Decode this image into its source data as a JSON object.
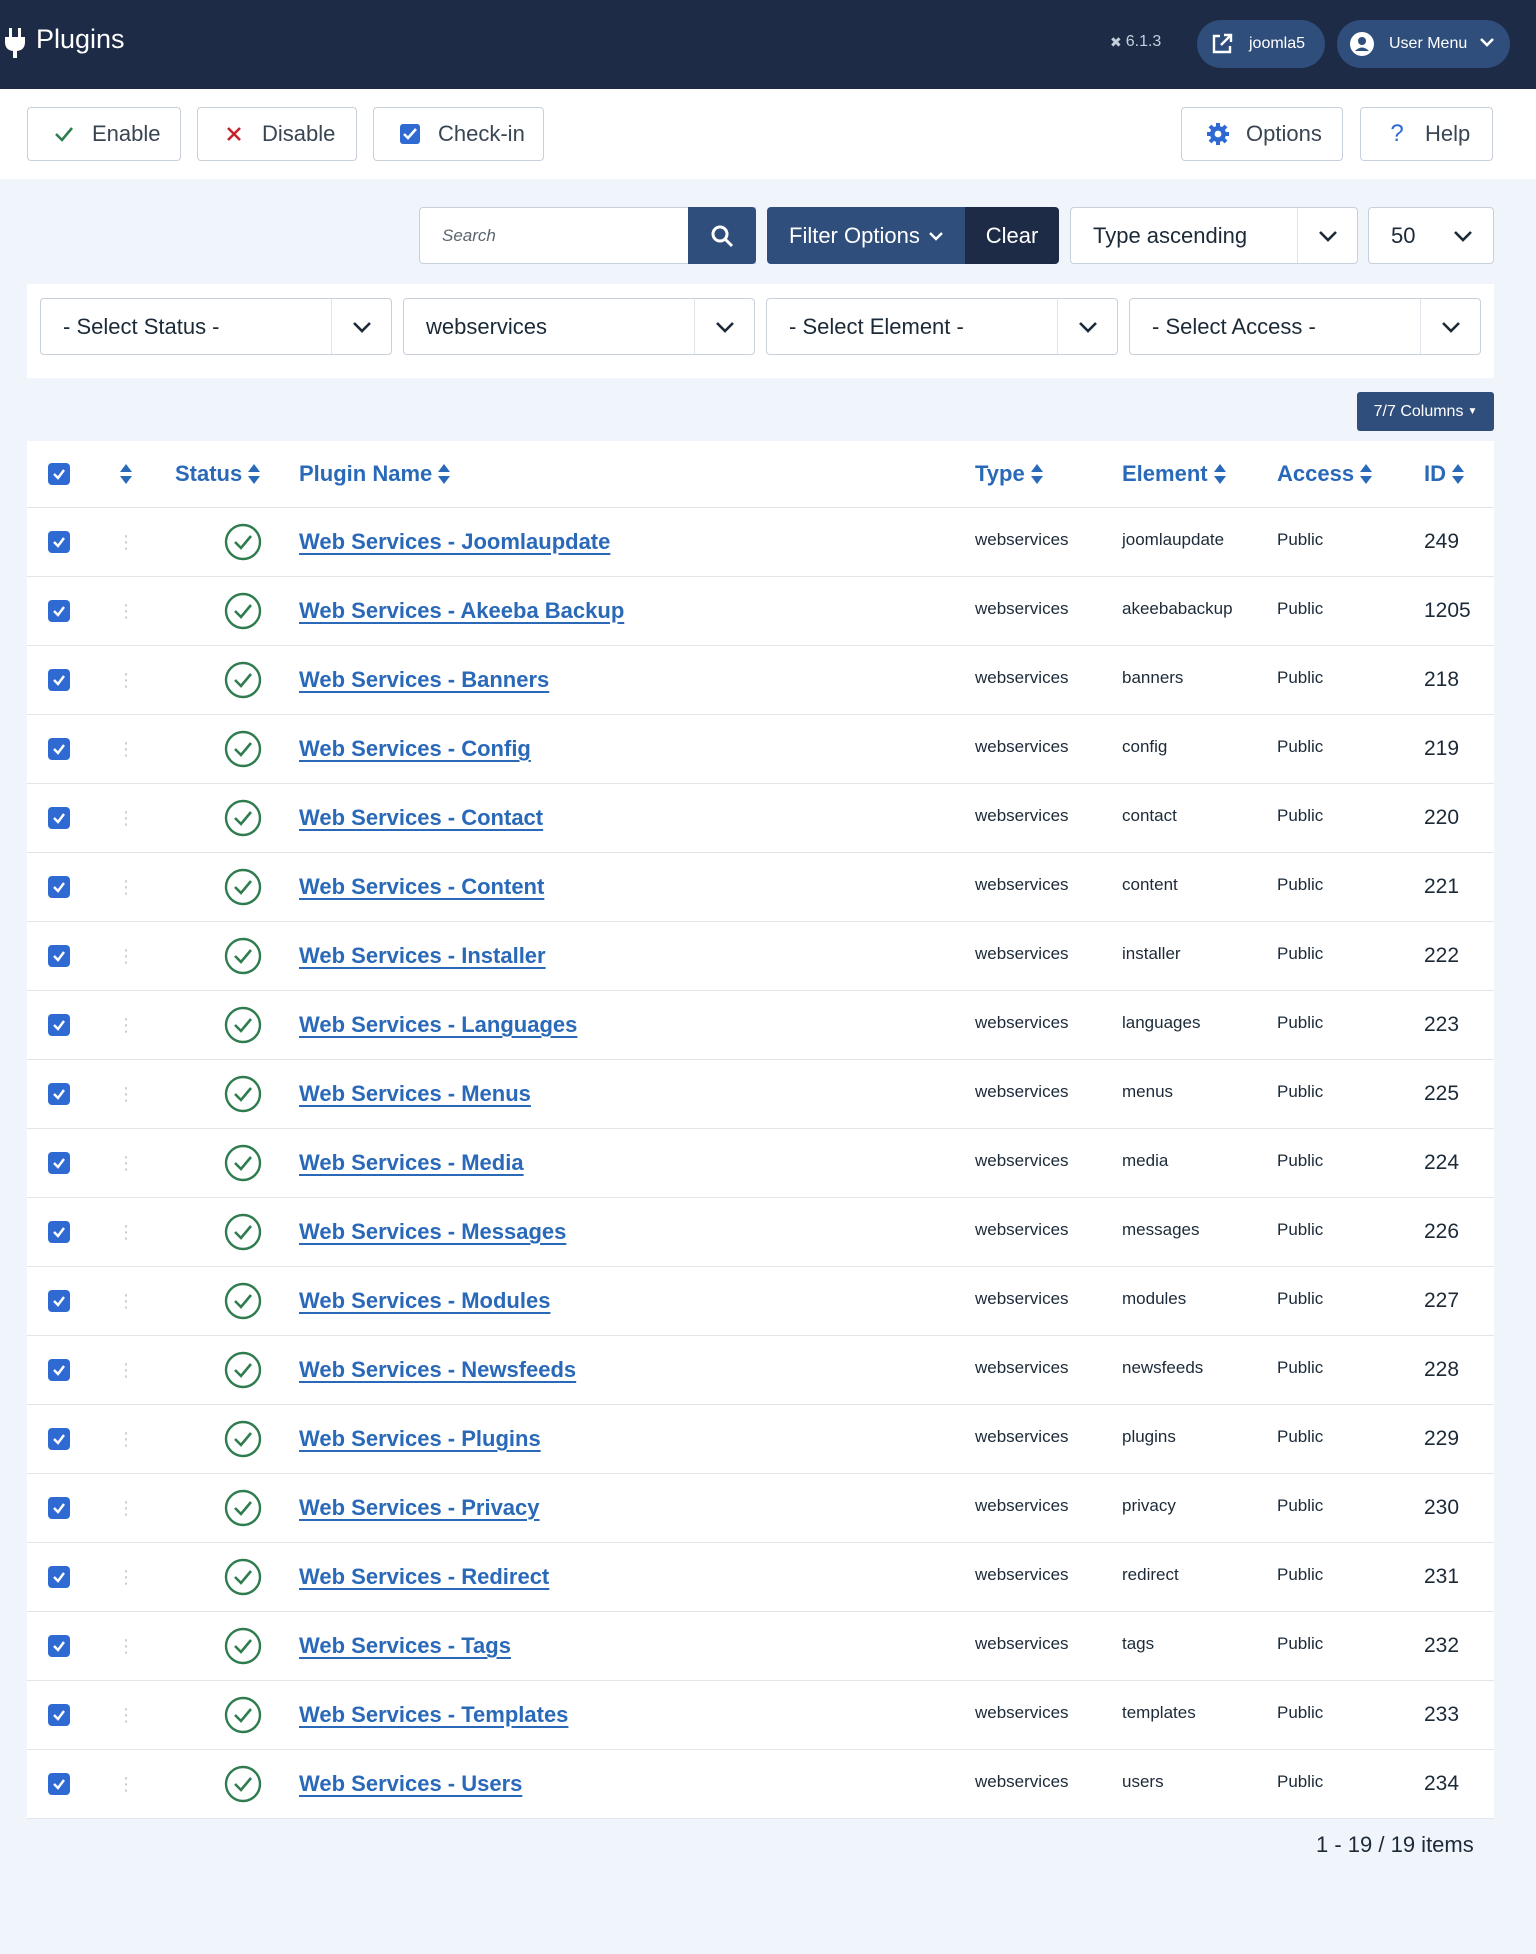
{
  "header": {
    "title": "Plugins",
    "version": "6.1.3",
    "site_label": "joomla5",
    "user_menu_label": "User Menu"
  },
  "toolbar": {
    "enable_label": "Enable",
    "disable_label": "Disable",
    "checkin_label": "Check-in",
    "options_label": "Options",
    "help_label": "Help"
  },
  "search": {
    "placeholder": "Search",
    "filter_options_label": "Filter Options",
    "clear_label": "Clear",
    "ordering_value": "Type ascending",
    "limit_value": "50"
  },
  "filters": {
    "status": "- Select Status -",
    "folder": "webservices",
    "element": "- Select Element -",
    "access": "- Select Access -"
  },
  "columns_button_label": "7/7 Columns",
  "table": {
    "headers": {
      "status": "Status",
      "name": "Plugin Name",
      "type": "Type",
      "element": "Element",
      "access": "Access",
      "id": "ID"
    },
    "rows": [
      {
        "name": "Web Services - Joomlaupdate",
        "type": "webservices",
        "element": "joomlaupdate",
        "access": "Public",
        "id": "249"
      },
      {
        "name": "Web Services - Akeeba Backup",
        "type": "webservices",
        "element": "akeebabackup",
        "access": "Public",
        "id": "1205"
      },
      {
        "name": "Web Services - Banners",
        "type": "webservices",
        "element": "banners",
        "access": "Public",
        "id": "218"
      },
      {
        "name": "Web Services - Config",
        "type": "webservices",
        "element": "config",
        "access": "Public",
        "id": "219"
      },
      {
        "name": "Web Services - Contact",
        "type": "webservices",
        "element": "contact",
        "access": "Public",
        "id": "220"
      },
      {
        "name": "Web Services - Content",
        "type": "webservices",
        "element": "content",
        "access": "Public",
        "id": "221"
      },
      {
        "name": "Web Services - Installer",
        "type": "webservices",
        "element": "installer",
        "access": "Public",
        "id": "222"
      },
      {
        "name": "Web Services - Languages",
        "type": "webservices",
        "element": "languages",
        "access": "Public",
        "id": "223"
      },
      {
        "name": "Web Services - Menus",
        "type": "webservices",
        "element": "menus",
        "access": "Public",
        "id": "225"
      },
      {
        "name": "Web Services - Media",
        "type": "webservices",
        "element": "media",
        "access": "Public",
        "id": "224"
      },
      {
        "name": "Web Services - Messages",
        "type": "webservices",
        "element": "messages",
        "access": "Public",
        "id": "226"
      },
      {
        "name": "Web Services - Modules",
        "type": "webservices",
        "element": "modules",
        "access": "Public",
        "id": "227"
      },
      {
        "name": "Web Services - Newsfeeds",
        "type": "webservices",
        "element": "newsfeeds",
        "access": "Public",
        "id": "228"
      },
      {
        "name": "Web Services - Plugins",
        "type": "webservices",
        "element": "plugins",
        "access": "Public",
        "id": "229"
      },
      {
        "name": "Web Services - Privacy",
        "type": "webservices",
        "element": "privacy",
        "access": "Public",
        "id": "230"
      },
      {
        "name": "Web Services - Redirect",
        "type": "webservices",
        "element": "redirect",
        "access": "Public",
        "id": "231"
      },
      {
        "name": "Web Services - Tags",
        "type": "webservices",
        "element": "tags",
        "access": "Public",
        "id": "232"
      },
      {
        "name": "Web Services - Templates",
        "type": "webservices",
        "element": "templates",
        "access": "Public",
        "id": "233"
      },
      {
        "name": "Web Services - Users",
        "type": "webservices",
        "element": "users",
        "access": "Public",
        "id": "234"
      }
    ]
  },
  "pagination_text": "1 - 19 / 19 items",
  "colors": {
    "header_bg": "#1d2b46",
    "primary": "#2f4e7c",
    "link": "#2a69b8",
    "checkbox": "#2f6ad3",
    "status_ok": "#2f7d4f",
    "disable_red": "#c5212b"
  },
  "icons": {
    "brand": "plug-icon",
    "version": "joomla-icon",
    "site": "external-link-icon",
    "user": "user-circle-icon",
    "enable": "check-icon",
    "disable": "x-icon",
    "checkin": "checkbox-icon",
    "options": "gear-icon",
    "help": "question-icon",
    "search": "search-icon",
    "status": "check-circle-icon"
  }
}
